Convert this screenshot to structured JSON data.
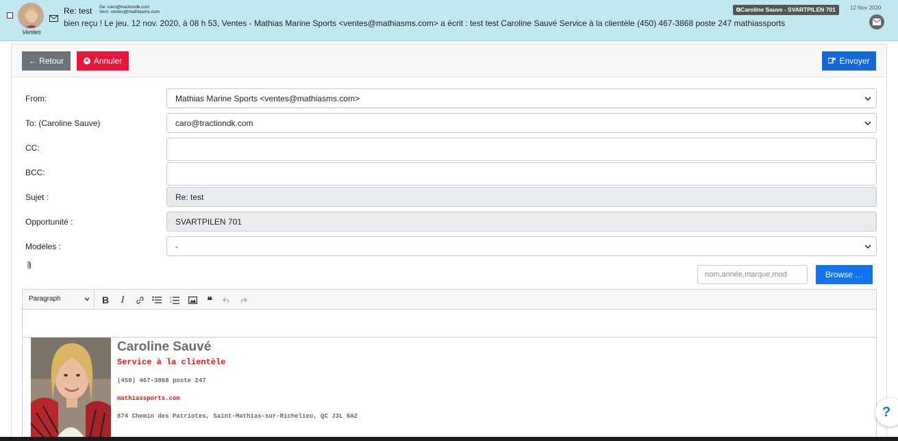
{
  "header": {
    "subject": "Re: test",
    "from_line": "De: caro@tractiondk.com",
    "to_line": "Vers: ventes@mathiasms.com",
    "preview": "bien reçu ! Le jeu. 12 nov. 2020, à 08 h 53, Ventes - Mathias Marine Sports <ventes@mathiasms.com> a écrit : test test Caroline Sauvé Service à la clientèle (450) 467-3868 poste 247 mathiassports",
    "avatar_label": "Ventes",
    "badge": "Caroline Sauve - SVARTPILEN 701",
    "date": "12 Nov 2020"
  },
  "toolbar": {
    "back_label": "← Retour",
    "cancel_label": "Annuler",
    "send_label": "Envoyer"
  },
  "form": {
    "from_label": "From:",
    "from_value": "Mathias Marine Sports <ventes@mathiasms.com>",
    "to_label": "To: (Caroline Sauve)",
    "to_value": "caro@tractiondk.com",
    "cc_label": "CC:",
    "cc_value": "",
    "bcc_label": "BCC:",
    "bcc_value": "",
    "subject_label": "Sujet :",
    "subject_value": "Re: test",
    "opportunity_label": "Opportunité :",
    "opportunity_value": "SVARTPILEN 701",
    "templates_label": "Modèles :",
    "templates_value": "-"
  },
  "attachments": {
    "search_placeholder": "nom,année,marque,mod",
    "browse_label": "Browse …"
  },
  "editor": {
    "block_format": "Paragraph"
  },
  "signature": {
    "name": "Caroline Sauvé",
    "role": "Service à la clientèle",
    "phone": "(450) 467-3868 poste 247",
    "website": "mathiassports.com",
    "address": "874 Chemin des Patriotes, Saint-Mathias-sur-Richelieu, QC J3L 6A2"
  },
  "help": {
    "label": "?"
  },
  "colors": {
    "header_bg": "#bfe9ee",
    "back_btn": "#6b7378",
    "cancel_btn": "#e8143c",
    "send_btn": "#1568d8",
    "browse_btn": "#1273f0",
    "signature_red": "#e11111"
  },
  "icons": {
    "mail": "envelope-icon",
    "cancel": "x-circle-icon",
    "send": "send-icon",
    "attach": "paperclip-icon",
    "help": "question-icon"
  }
}
